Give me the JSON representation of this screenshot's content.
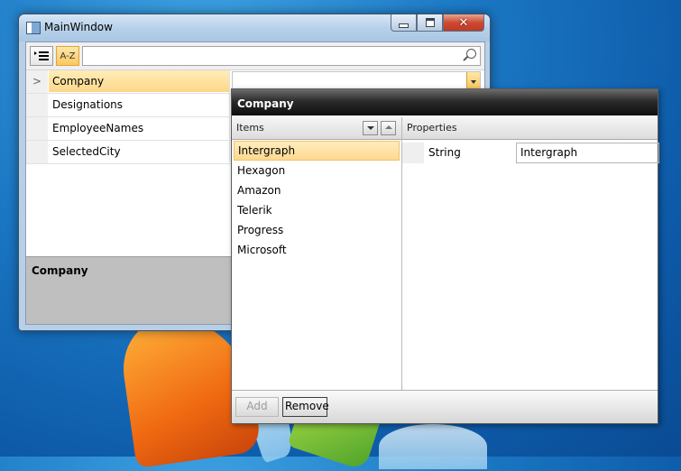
{
  "window": {
    "title": "MainWindow"
  },
  "toolbar": {
    "categorize_icon": "categorized-list-icon",
    "sort_label": "A-Z",
    "search_placeholder": "",
    "search_icon": "search-icon"
  },
  "grid": {
    "rows": [
      {
        "name": "Company",
        "selected": true,
        "expander": ">"
      },
      {
        "name": "Designations"
      },
      {
        "name": "EmployeeNames"
      },
      {
        "name": "SelectedCity"
      }
    ]
  },
  "description": {
    "title": "Company"
  },
  "editor": {
    "title": "Company",
    "items_header": "Items",
    "properties_header": "Properties",
    "items": [
      "Intergraph",
      "Hexagon",
      "Amazon",
      "Telerik",
      "Progress",
      "Microsoft"
    ],
    "selected_index": 0,
    "property": {
      "type": "String",
      "value": "Intergraph"
    },
    "add_label": "Add",
    "remove_label": "Remove"
  },
  "colors": {
    "selection": "#fdd789",
    "header": "#0e0e0e",
    "desktop": "#1b78c4"
  }
}
